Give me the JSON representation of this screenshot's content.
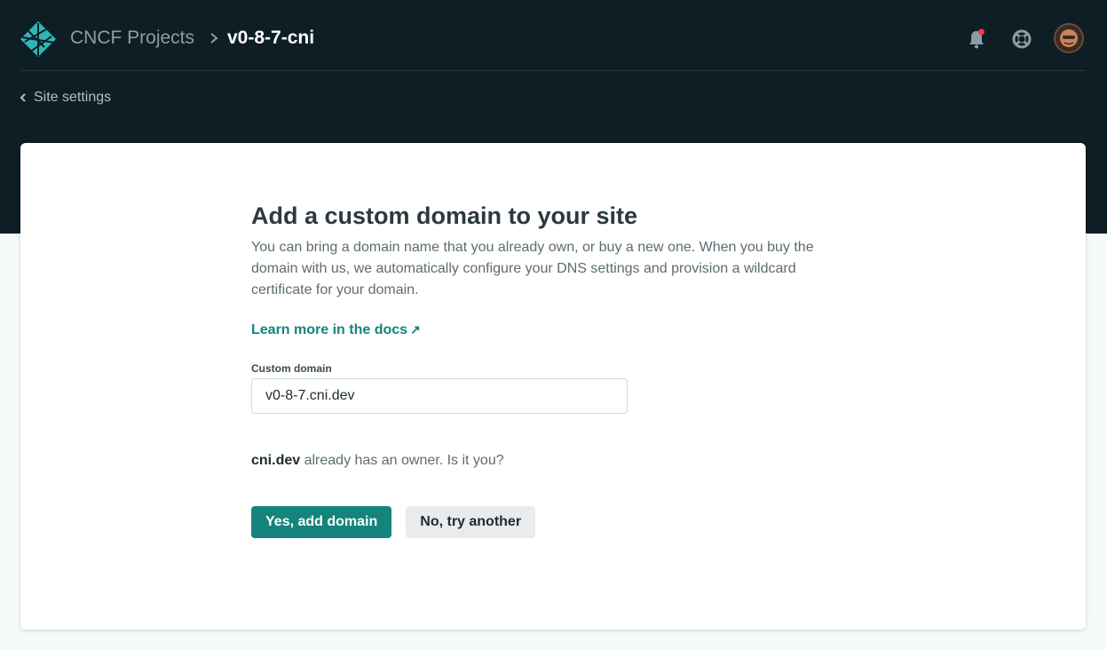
{
  "header": {
    "team_name": "CNCF Projects",
    "site_name": "v0-8-7-cni"
  },
  "nav": {
    "back_label": "Site settings"
  },
  "panel": {
    "title": "Add a custom domain to your site",
    "description": "You can bring a domain name that you already own, or buy a new one. When you buy the domain with us, we automatically configure your DNS settings and provision a wildcard certificate for your domain.",
    "docs_link": "Learn more in the docs",
    "docs_link_arrow": "↗",
    "field_label": "Custom domain",
    "field_value": "v0-8-7.cni.dev",
    "owner_domain": "cni.dev",
    "owner_message": " already has an owner. Is it you?",
    "confirm_button": "Yes, add domain",
    "reject_button": "No, try another"
  },
  "colors": {
    "header_bg": "#0e1e25",
    "accent": "#15847d",
    "notification_dot": "#fa3946"
  },
  "icons": [
    "netlify-logo",
    "chevron-right-icon",
    "bell-icon",
    "help-lifebuoy-icon",
    "avatar",
    "chevron-left-icon"
  ]
}
